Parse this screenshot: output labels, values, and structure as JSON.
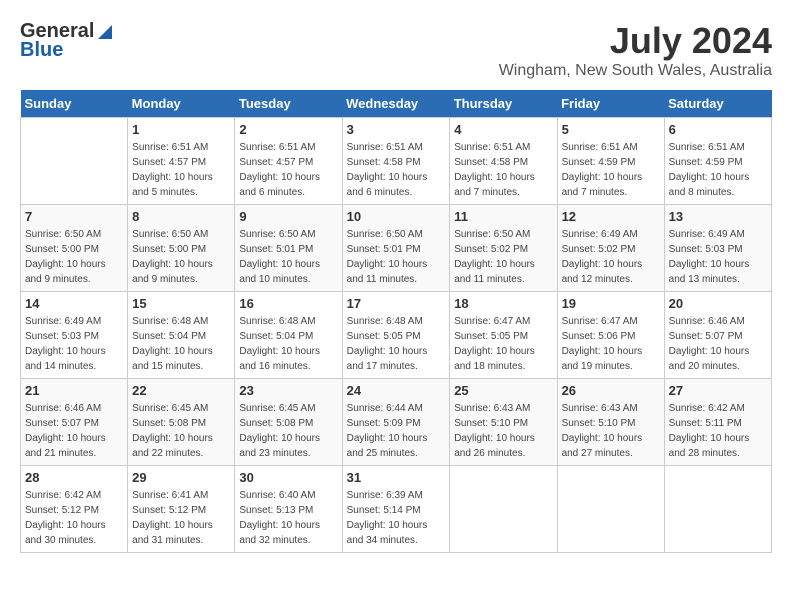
{
  "header": {
    "logo_general": "General",
    "logo_blue": "Blue",
    "title": "July 2024",
    "location": "Wingham, New South Wales, Australia"
  },
  "days_of_week": [
    "Sunday",
    "Monday",
    "Tuesday",
    "Wednesday",
    "Thursday",
    "Friday",
    "Saturday"
  ],
  "weeks": [
    [
      {
        "day": "",
        "details": ""
      },
      {
        "day": "1",
        "details": "Sunrise: 6:51 AM\nSunset: 4:57 PM\nDaylight: 10 hours\nand 5 minutes."
      },
      {
        "day": "2",
        "details": "Sunrise: 6:51 AM\nSunset: 4:57 PM\nDaylight: 10 hours\nand 6 minutes."
      },
      {
        "day": "3",
        "details": "Sunrise: 6:51 AM\nSunset: 4:58 PM\nDaylight: 10 hours\nand 6 minutes."
      },
      {
        "day": "4",
        "details": "Sunrise: 6:51 AM\nSunset: 4:58 PM\nDaylight: 10 hours\nand 7 minutes."
      },
      {
        "day": "5",
        "details": "Sunrise: 6:51 AM\nSunset: 4:59 PM\nDaylight: 10 hours\nand 7 minutes."
      },
      {
        "day": "6",
        "details": "Sunrise: 6:51 AM\nSunset: 4:59 PM\nDaylight: 10 hours\nand 8 minutes."
      }
    ],
    [
      {
        "day": "7",
        "details": "Sunrise: 6:50 AM\nSunset: 5:00 PM\nDaylight: 10 hours\nand 9 minutes."
      },
      {
        "day": "8",
        "details": "Sunrise: 6:50 AM\nSunset: 5:00 PM\nDaylight: 10 hours\nand 9 minutes."
      },
      {
        "day": "9",
        "details": "Sunrise: 6:50 AM\nSunset: 5:01 PM\nDaylight: 10 hours\nand 10 minutes."
      },
      {
        "day": "10",
        "details": "Sunrise: 6:50 AM\nSunset: 5:01 PM\nDaylight: 10 hours\nand 11 minutes."
      },
      {
        "day": "11",
        "details": "Sunrise: 6:50 AM\nSunset: 5:02 PM\nDaylight: 10 hours\nand 11 minutes."
      },
      {
        "day": "12",
        "details": "Sunrise: 6:49 AM\nSunset: 5:02 PM\nDaylight: 10 hours\nand 12 minutes."
      },
      {
        "day": "13",
        "details": "Sunrise: 6:49 AM\nSunset: 5:03 PM\nDaylight: 10 hours\nand 13 minutes."
      }
    ],
    [
      {
        "day": "14",
        "details": "Sunrise: 6:49 AM\nSunset: 5:03 PM\nDaylight: 10 hours\nand 14 minutes."
      },
      {
        "day": "15",
        "details": "Sunrise: 6:48 AM\nSunset: 5:04 PM\nDaylight: 10 hours\nand 15 minutes."
      },
      {
        "day": "16",
        "details": "Sunrise: 6:48 AM\nSunset: 5:04 PM\nDaylight: 10 hours\nand 16 minutes."
      },
      {
        "day": "17",
        "details": "Sunrise: 6:48 AM\nSunset: 5:05 PM\nDaylight: 10 hours\nand 17 minutes."
      },
      {
        "day": "18",
        "details": "Sunrise: 6:47 AM\nSunset: 5:05 PM\nDaylight: 10 hours\nand 18 minutes."
      },
      {
        "day": "19",
        "details": "Sunrise: 6:47 AM\nSunset: 5:06 PM\nDaylight: 10 hours\nand 19 minutes."
      },
      {
        "day": "20",
        "details": "Sunrise: 6:46 AM\nSunset: 5:07 PM\nDaylight: 10 hours\nand 20 minutes."
      }
    ],
    [
      {
        "day": "21",
        "details": "Sunrise: 6:46 AM\nSunset: 5:07 PM\nDaylight: 10 hours\nand 21 minutes."
      },
      {
        "day": "22",
        "details": "Sunrise: 6:45 AM\nSunset: 5:08 PM\nDaylight: 10 hours\nand 22 minutes."
      },
      {
        "day": "23",
        "details": "Sunrise: 6:45 AM\nSunset: 5:08 PM\nDaylight: 10 hours\nand 23 minutes."
      },
      {
        "day": "24",
        "details": "Sunrise: 6:44 AM\nSunset: 5:09 PM\nDaylight: 10 hours\nand 25 minutes."
      },
      {
        "day": "25",
        "details": "Sunrise: 6:43 AM\nSunset: 5:10 PM\nDaylight: 10 hours\nand 26 minutes."
      },
      {
        "day": "26",
        "details": "Sunrise: 6:43 AM\nSunset: 5:10 PM\nDaylight: 10 hours\nand 27 minutes."
      },
      {
        "day": "27",
        "details": "Sunrise: 6:42 AM\nSunset: 5:11 PM\nDaylight: 10 hours\nand 28 minutes."
      }
    ],
    [
      {
        "day": "28",
        "details": "Sunrise: 6:42 AM\nSunset: 5:12 PM\nDaylight: 10 hours\nand 30 minutes."
      },
      {
        "day": "29",
        "details": "Sunrise: 6:41 AM\nSunset: 5:12 PM\nDaylight: 10 hours\nand 31 minutes."
      },
      {
        "day": "30",
        "details": "Sunrise: 6:40 AM\nSunset: 5:13 PM\nDaylight: 10 hours\nand 32 minutes."
      },
      {
        "day": "31",
        "details": "Sunrise: 6:39 AM\nSunset: 5:14 PM\nDaylight: 10 hours\nand 34 minutes."
      },
      {
        "day": "",
        "details": ""
      },
      {
        "day": "",
        "details": ""
      },
      {
        "day": "",
        "details": ""
      }
    ]
  ]
}
